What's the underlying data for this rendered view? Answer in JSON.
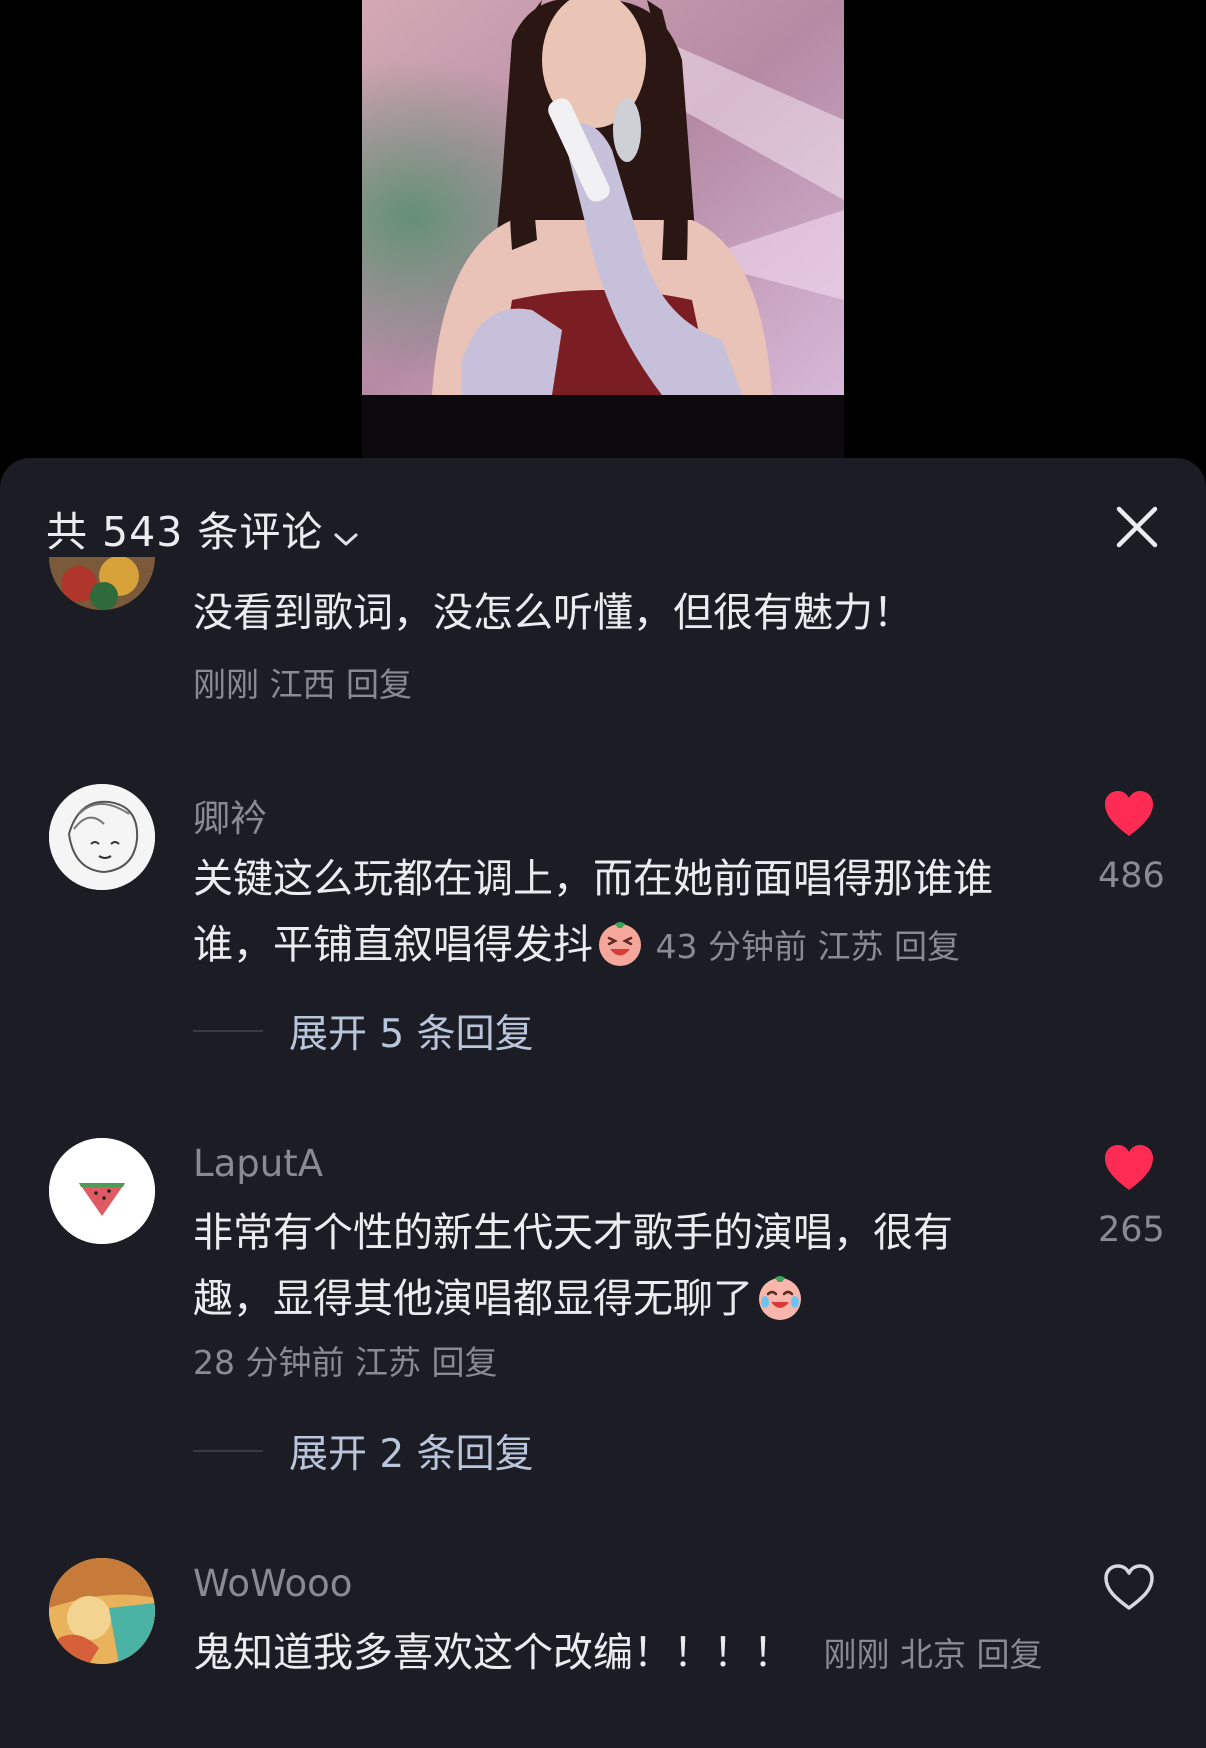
{
  "sheet": {
    "comment_count_label": "共 543 条评论",
    "chevron_icon": "chevron-down-icon",
    "close_icon": "close-icon"
  },
  "colors": {
    "sheet_bg": "#1c1c24",
    "like_active": "#fe2c55",
    "meta_text": "#8a8a93",
    "expand_text": "#b9c5da"
  },
  "comments": [
    {
      "text": "没看到歌词，没怎么听懂，但很有魅力！",
      "time": "刚刚",
      "location": "江西",
      "reply_label": "回复"
    },
    {
      "username": "卿衿",
      "text": "关键这么玩都在调上，而在她前面唱得那谁谁谁，平铺直叙唱得发抖",
      "emoji": "laughing-emoji-icon",
      "time": "43 分钟前",
      "location": "江苏",
      "reply_label": "回复",
      "liked": true,
      "like_count": "486",
      "expand_label": "展开 5 条回复"
    },
    {
      "username": "LaputA",
      "text": "非常有个性的新生代天才歌手的演唱，很有趣，显得其他演唱都显得无聊了",
      "emoji": "crying-laughing-emoji-icon",
      "time": "28 分钟前",
      "location": "江苏",
      "reply_label": "回复",
      "liked": true,
      "like_count": "265",
      "expand_label": "展开 2 条回复"
    },
    {
      "username": "WoWooo",
      "text": "鬼知道我多喜欢这个改编！！！！",
      "time": "刚刚",
      "location": "北京",
      "reply_label": "回复",
      "liked": false
    }
  ]
}
